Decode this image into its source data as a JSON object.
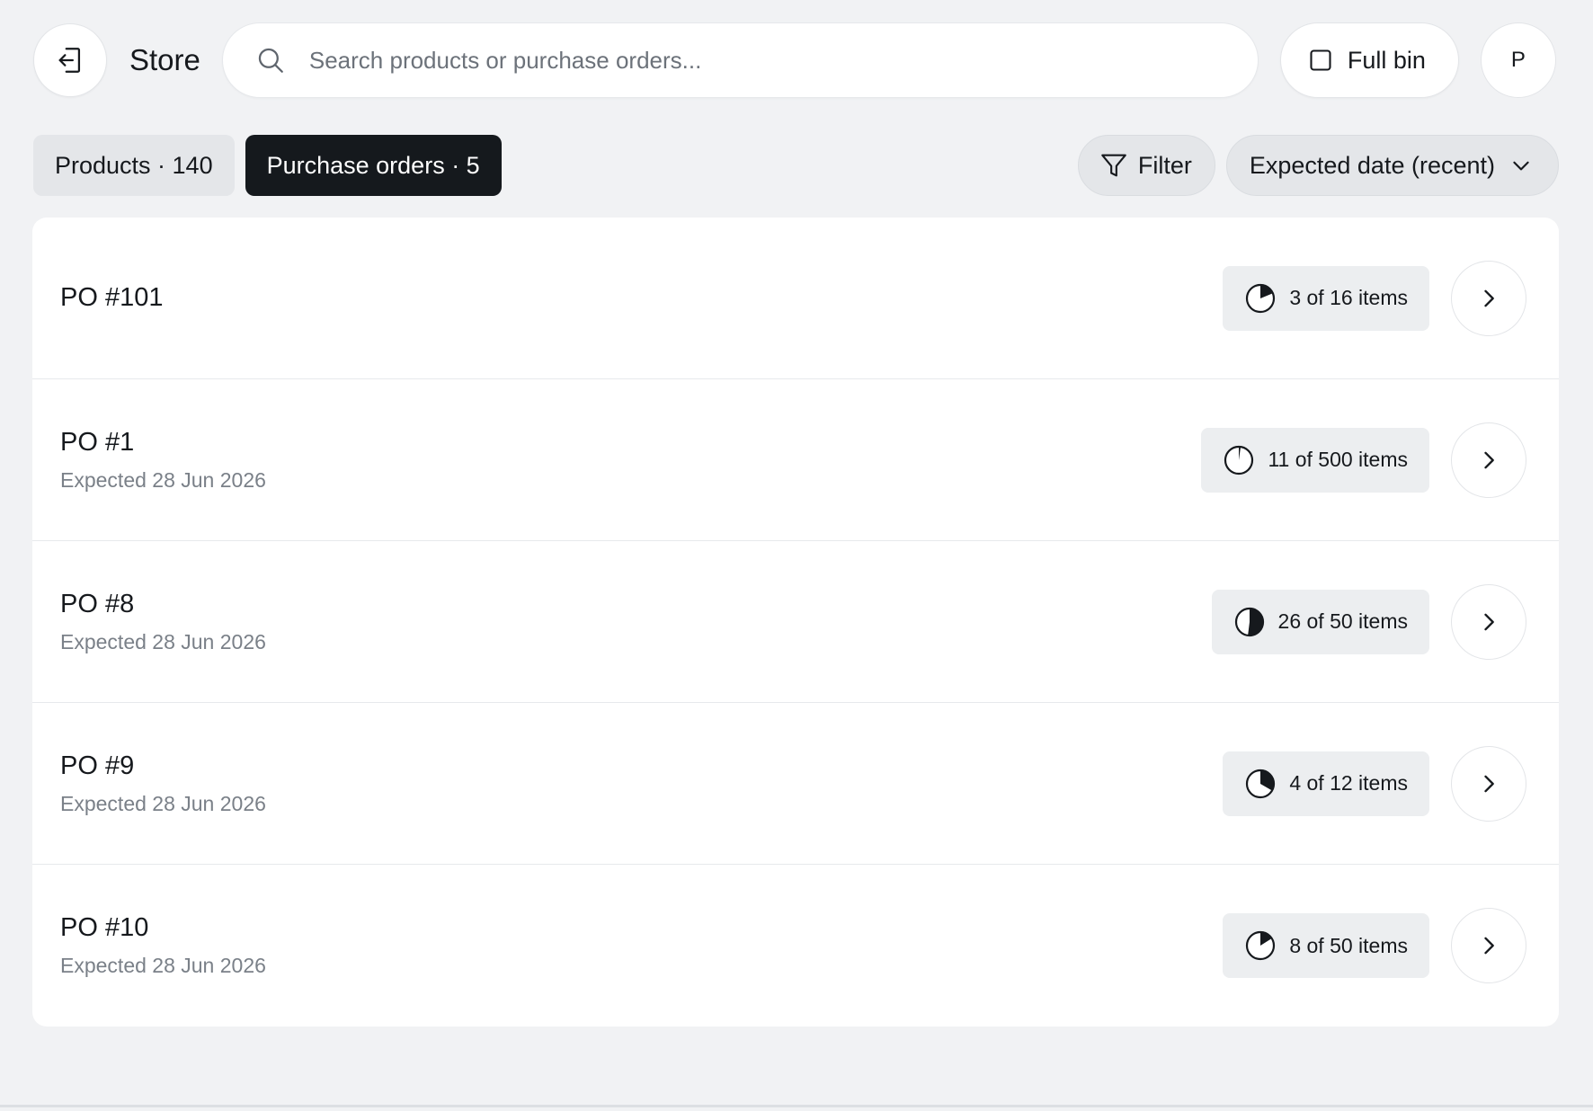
{
  "header": {
    "title": "Store",
    "search_placeholder": "Search products or purchase orders...",
    "full_bin_label": "Full bin",
    "avatar_initial": "P"
  },
  "tabs": [
    {
      "label": "Products · 140",
      "active": false
    },
    {
      "label": "Purchase orders · 5",
      "active": true
    }
  ],
  "toolbar": {
    "filter_label": "Filter",
    "sort_label": "Expected date (recent)"
  },
  "purchase_orders": [
    {
      "title": "PO #101",
      "subtitle": "",
      "received": 3,
      "total": 16,
      "progress_label": "3 of 16 items"
    },
    {
      "title": "PO #1",
      "subtitle": "Expected 28 Jun 2026",
      "received": 11,
      "total": 500,
      "progress_label": "11 of 500 items"
    },
    {
      "title": "PO #8",
      "subtitle": "Expected 28 Jun 2026",
      "received": 26,
      "total": 50,
      "progress_label": "26 of 50 items"
    },
    {
      "title": "PO #9",
      "subtitle": "Expected 28 Jun 2026",
      "received": 4,
      "total": 12,
      "progress_label": "4 of 12 items"
    },
    {
      "title": "PO #10",
      "subtitle": "Expected 28 Jun 2026",
      "received": 8,
      "total": 50,
      "progress_label": "8 of 50 items"
    }
  ],
  "icons": {
    "back": "exit-icon",
    "search": "search-icon",
    "full_bin": "checkbox-icon",
    "filter": "funnel-icon",
    "sort": "chevron-down-icon",
    "progress": "pie-progress-icon",
    "row_action": "chevron-right-icon"
  }
}
